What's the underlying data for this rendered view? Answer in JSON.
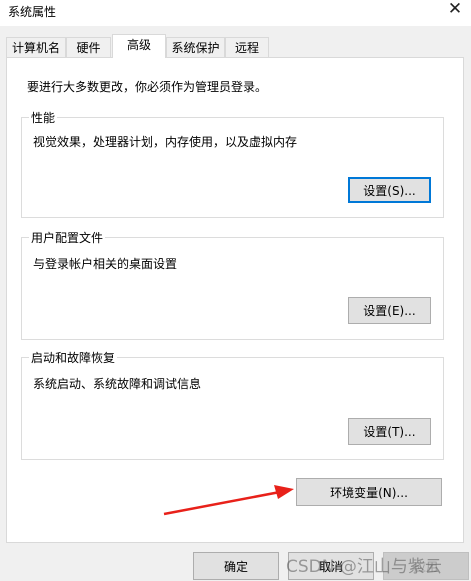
{
  "window": {
    "title": "系统属性",
    "close_glyph": "✕"
  },
  "tabs": [
    {
      "label": "计算机名"
    },
    {
      "label": "硬件"
    },
    {
      "label": "高级",
      "active": true
    },
    {
      "label": "系统保护"
    },
    {
      "label": "远程"
    }
  ],
  "notice": "要进行大多数更改，你必须作为管理员登录。",
  "performance": {
    "title": "性能",
    "desc": "视觉效果，处理器计划，内存使用，以及虚拟内存",
    "button": "设置(S)..."
  },
  "user_profiles": {
    "title": "用户配置文件",
    "desc": "与登录帐户相关的桌面设置",
    "button": "设置(E)..."
  },
  "startup_recovery": {
    "title": "启动和故障恢复",
    "desc": "系统启动、系统故障和调试信息",
    "button": "设置(T)..."
  },
  "env_button": "环境变量(N)...",
  "footer": {
    "ok": "确定",
    "cancel": "取消",
    "apply": "应用"
  },
  "watermark": "CSDN @江山与紫云",
  "colors": {
    "arrow": "#e8211a",
    "focus": "#0078d7"
  }
}
